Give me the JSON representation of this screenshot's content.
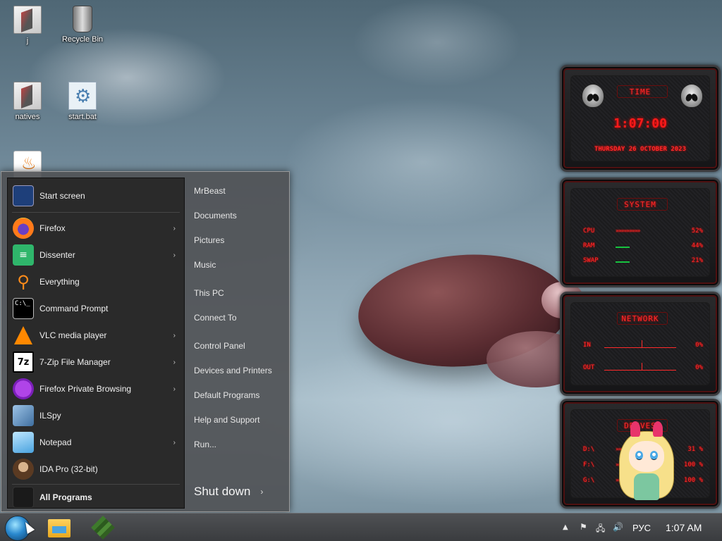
{
  "desktop": {
    "icons": [
      {
        "label": "j",
        "icon": "folder-icon"
      },
      {
        "label": "Recycle Bin",
        "icon": "recycle-bin-icon"
      },
      {
        "label": "natives",
        "icon": "folder-icon"
      },
      {
        "label": "start.bat",
        "icon": "batch-file-icon"
      },
      {
        "label": "",
        "icon": "java-icon"
      }
    ]
  },
  "start_menu": {
    "pinned": [
      {
        "label": "Start screen",
        "icon": "start-screen-icon",
        "submenu": false
      },
      {
        "label": "Firefox",
        "icon": "firefox-icon",
        "submenu": true
      },
      {
        "label": "Dissenter",
        "icon": "dissenter-icon",
        "submenu": true
      },
      {
        "label": "Everything",
        "icon": "everything-search-icon",
        "submenu": false
      },
      {
        "label": "Command Prompt",
        "icon": "command-prompt-icon",
        "submenu": false
      },
      {
        "label": "VLC media player",
        "icon": "vlc-icon",
        "submenu": true
      },
      {
        "label": "7-Zip File Manager",
        "icon": "7zip-icon",
        "submenu": true
      },
      {
        "label": "Firefox Private Browsing",
        "icon": "firefox-private-icon",
        "submenu": true
      },
      {
        "label": "ILSpy",
        "icon": "ilspy-icon",
        "submenu": false
      },
      {
        "label": "Notepad",
        "icon": "notepad-icon",
        "submenu": true
      },
      {
        "label": "IDA Pro (32-bit)",
        "icon": "ida-pro-icon",
        "submenu": false
      }
    ],
    "all_programs": "All Programs",
    "cmd_glyph": "C:\\_",
    "seven_zip_glyph": "7z",
    "right_links": [
      "MrBeast",
      "Documents",
      "Pictures",
      "Music",
      "This PC",
      "Connect To",
      "Control Panel",
      "Devices and Printers",
      "Default Programs",
      "Help and Support",
      "Run..."
    ],
    "shutdown": "Shut down",
    "shutdown_arrow": "›",
    "submenu_arrow": "›"
  },
  "widgets": {
    "time": {
      "title": "TIME",
      "clock": "1:07:00",
      "date": "THURSDAY 26 OCTOBER 2023"
    },
    "system": {
      "title": "SYSTEM",
      "rows": [
        {
          "label": "CPU",
          "bar": "»»»»»»»»»",
          "value": "52%"
        },
        {
          "label": "RAM",
          "bar": "",
          "value": "44%"
        },
        {
          "label": "SWAP",
          "bar": "",
          "value": "21%"
        }
      ]
    },
    "network": {
      "title": "NETWORK",
      "rows": [
        {
          "label": "IN",
          "value": "0%"
        },
        {
          "label": "OUT",
          "value": "0%"
        }
      ]
    },
    "drives": {
      "title": "DRIVES",
      "rows": [
        {
          "label": "D:\\",
          "bar": "»»»»",
          "value": "31 %"
        },
        {
          "label": "F:\\",
          "bar": "»»»»»»»»»»",
          "value": "100 %"
        },
        {
          "label": "G:\\",
          "bar": "»»»»»»»»»»",
          "value": "100 %"
        }
      ]
    },
    "accent_color": "#ff2a2a"
  },
  "taskbar": {
    "pinned": [
      "start-orb-icon",
      "file-explorer-icon",
      "minecraft-icon"
    ],
    "tray": {
      "chevron": "▲",
      "flag": "⚑",
      "network": "🖧",
      "volume": "🔊",
      "language": "РУС",
      "clock": "1:07 AM"
    }
  }
}
